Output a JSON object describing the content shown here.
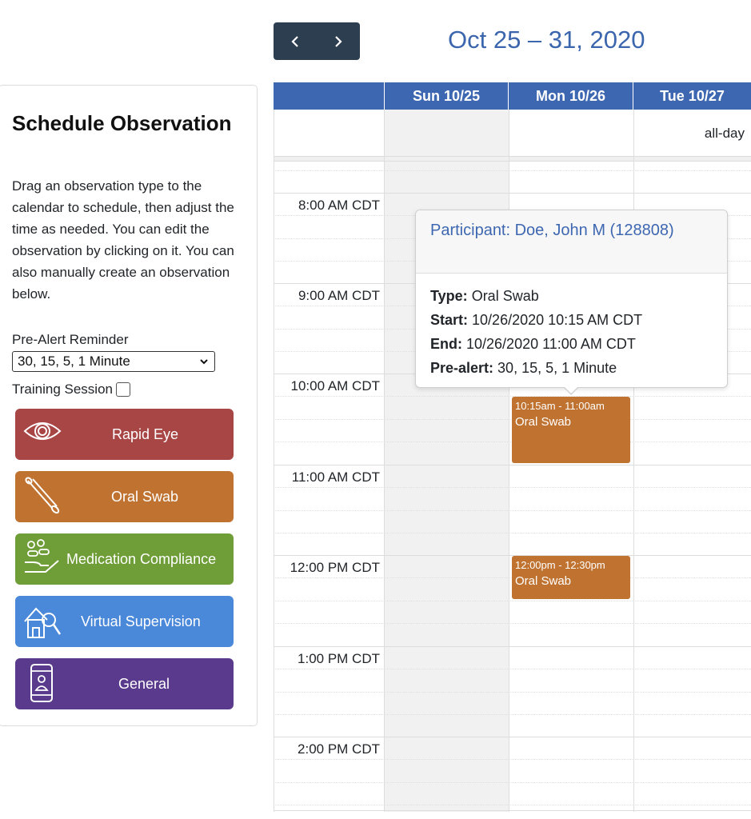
{
  "sidebar": {
    "title": "Schedule Observation",
    "description": "Drag an observation type to the calendar to schedule, then adjust the time as needed. You can edit the observation by clicking on it. You can also manually create an observation below.",
    "prealert_label": "Pre-Alert Reminder",
    "prealert_value": "30, 15, 5, 1 Minute",
    "training_label": "Training Session",
    "training_checked": false,
    "observation_types": [
      {
        "label": "Rapid Eye",
        "icon": "eye-icon",
        "color": "#a84545"
      },
      {
        "label": "Oral Swab",
        "icon": "swab-icon",
        "color": "#c07230"
      },
      {
        "label": "Medication Compliance",
        "icon": "pills-hand-icon",
        "color": "#6f9d37"
      },
      {
        "label": "Virtual Supervision",
        "icon": "house-magnifier-icon",
        "color": "#4a88d9"
      },
      {
        "label": "General",
        "icon": "phone-person-icon",
        "color": "#5a3a8c"
      }
    ]
  },
  "header": {
    "prev_icon": "chevron-left-icon",
    "next_icon": "chevron-right-icon",
    "date_range": "Oct 25 – 31, 2020"
  },
  "calendar": {
    "days": [
      "Sun 10/25",
      "Mon 10/26",
      "Tue 10/27"
    ],
    "all_day_label": "all-day",
    "time_slots": [
      "8:00 AM CDT",
      "9:00 AM CDT",
      "10:00 AM CDT",
      "11:00 AM CDT",
      "12:00 PM CDT",
      "1:00 PM CDT",
      "2:00 PM CDT"
    ],
    "events": [
      {
        "day": "Mon 10/26",
        "time": "10:15am - 11:00am",
        "title": "Oral Swab",
        "color": "#c07230"
      },
      {
        "day": "Mon 10/26",
        "time": "12:00pm - 12:30pm",
        "title": "Oral Swab",
        "color": "#c07230"
      }
    ],
    "header_color": "#3e67b1"
  },
  "popover": {
    "title": "Participant: Doe, John M (128808)",
    "rows": [
      {
        "label": "Type:",
        "value": "Oral Swab"
      },
      {
        "label": "Start:",
        "value": "10/26/2020 10:15 AM CDT"
      },
      {
        "label": "End:",
        "value": "10/26/2020 11:00 AM CDT"
      },
      {
        "label": "Pre-alert:",
        "value": "30, 15, 5, 1 Minute"
      }
    ]
  }
}
